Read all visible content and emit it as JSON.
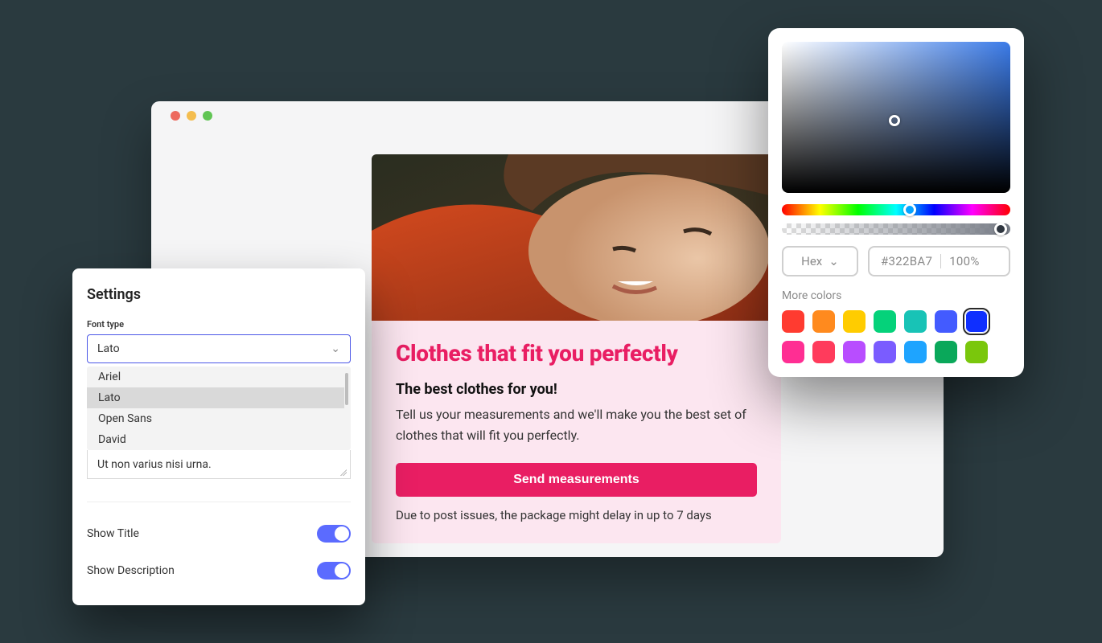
{
  "card": {
    "title": "Clothes that fit you perfectly",
    "subtitle": "The best clothes for you!",
    "body": "Tell us your measurements and we'll make you the best set of clothes that will fit you perfectly.",
    "cta": "Send measurements",
    "footnote": "Due to post issues, the package might delay in up to 7 days",
    "accent": "#e91e63"
  },
  "settings": {
    "title": "Settings",
    "font_label": "Font type",
    "font_selected": "Lato",
    "font_options": [
      "Ariel",
      "Lato",
      "Open Sans",
      "David"
    ],
    "extra_text": "Ut non varius nisi urna.",
    "toggles": [
      {
        "label": "Show Title",
        "on": true
      },
      {
        "label": "Show Description",
        "on": true
      }
    ]
  },
  "picker": {
    "format": "Hex",
    "value": "#322BA7",
    "opacity": "100%",
    "more": "More colors",
    "swatches": [
      "#ff3b30",
      "#ff8a1e",
      "#ffcc00",
      "#05d27a",
      "#18c3b6",
      "#435bff",
      "#0f2fff",
      "#ff2e93",
      "#ff3b5c",
      "#b84dff",
      "#7a5cff",
      "#1ea4ff",
      "#0aa85a",
      "#7ac70c"
    ],
    "selected_swatch": 6
  }
}
